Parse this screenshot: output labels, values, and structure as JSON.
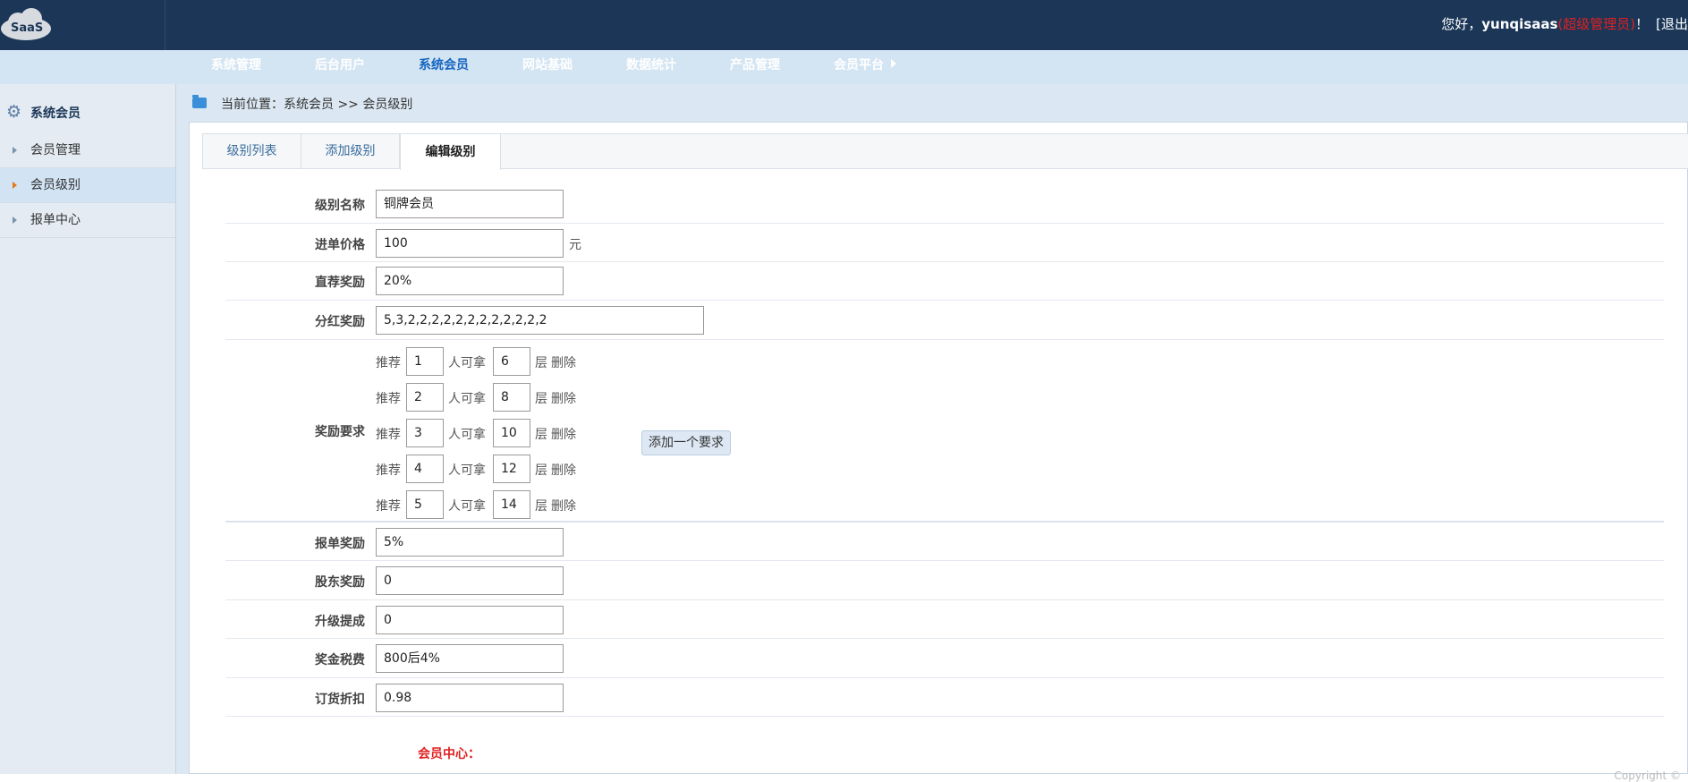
{
  "brand": {
    "logo_text": "SaaS"
  },
  "user": {
    "greeting": "您好，",
    "name": "yunqisaas",
    "role": "(超级管理员)",
    "suffix": "！",
    "logout": "[退出"
  },
  "nav": {
    "items": [
      "系统管理",
      "后台用户",
      "系统会员",
      "网站基础",
      "数据统计",
      "产品管理",
      "会员平台"
    ],
    "active_index": 2
  },
  "sidebar": {
    "title": "系统会员",
    "items": [
      {
        "label": "会员管理"
      },
      {
        "label": "会员级别"
      },
      {
        "label": "报单中心"
      }
    ],
    "active_index": 1
  },
  "breadcrumb": {
    "prefix": "当前位置：",
    "path": "系统会员 >> 会员级别"
  },
  "tabs": [
    "级别列表",
    "添加级别",
    "编辑级别"
  ],
  "active_tab": 2,
  "form": {
    "level_name": {
      "label": "级别名称",
      "value": "铜牌会员"
    },
    "entry_price": {
      "label": "进单价格",
      "value": "100",
      "unit": "元"
    },
    "direct_reward": {
      "label": "直荐奖励",
      "value": "20%"
    },
    "dividend_reward": {
      "label": "分红奖励",
      "value": "5,3,2,2,2,2,2,2,2,2,2,2,2,2"
    },
    "reward_requirements": {
      "label": "奖励要求",
      "prefix": "推荐",
      "middle": "人可拿",
      "suffix": "层",
      "delete_label": "删除",
      "add_label": "添加一个要求",
      "rows": [
        {
          "people": "1",
          "layers": "6"
        },
        {
          "people": "2",
          "layers": "8"
        },
        {
          "people": "3",
          "layers": "10"
        },
        {
          "people": "4",
          "layers": "12"
        },
        {
          "people": "5",
          "layers": "14"
        }
      ]
    },
    "report_reward": {
      "label": "报单奖励",
      "value": "5%"
    },
    "shareholder_reward": {
      "label": "股东奖励",
      "value": "0"
    },
    "upgrade_commission": {
      "label": "升级提成",
      "value": "0"
    },
    "bonus_tax": {
      "label": "奖金税费",
      "value": "800后4%"
    },
    "order_discount": {
      "label": "订货折扣",
      "value": "0.98"
    }
  },
  "section": {
    "member_center_title": "会员中心："
  },
  "footer": {
    "copyright": "Copyright ©"
  },
  "colors": {
    "topbar": "#1b3657",
    "nav_bg": "#d3e4f2",
    "accent_red": "#e02020",
    "link_blue": "#1565c0"
  }
}
